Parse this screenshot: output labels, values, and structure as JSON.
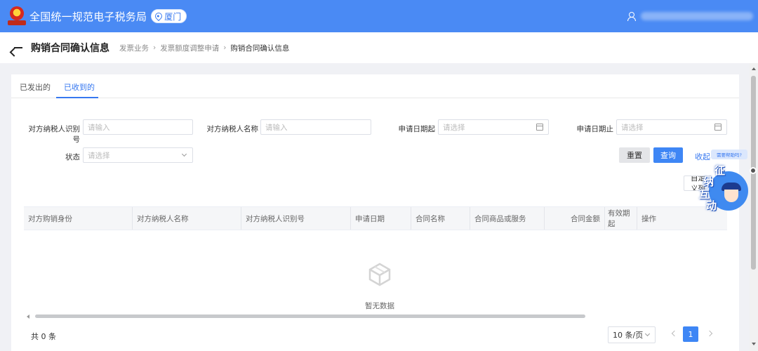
{
  "header": {
    "app_title": "全国统一规范电子税务局",
    "city": "厦门"
  },
  "page": {
    "title": "购销合同确认信息",
    "breadcrumbs": [
      "发票业务",
      "发票额度调整申请",
      "购销合同确认信息"
    ]
  },
  "tabs": [
    {
      "label": "已发出的",
      "active": false
    },
    {
      "label": "已收到的",
      "active": true
    }
  ],
  "filters": {
    "counterparty_id": {
      "label": "对方纳税人识别号",
      "placeholder": "请输入"
    },
    "counterparty_name": {
      "label": "对方纳税人名称",
      "placeholder": "请输入"
    },
    "date_start": {
      "label": "申请日期起",
      "placeholder": "请选择"
    },
    "date_end": {
      "label": "申请日期止",
      "placeholder": "请选择"
    },
    "status": {
      "label": "状态",
      "placeholder": "请选择"
    }
  },
  "actions": {
    "reset": "重置",
    "query": "查询",
    "collapse": "收起",
    "help": "需要帮助吗?",
    "custom_columns": "自定义列"
  },
  "table": {
    "columns": [
      "对方购销身份",
      "对方纳税人名称",
      "对方纳税人识别号",
      "申请日期",
      "合同名称",
      "合同商品或服务",
      "合同金额",
      "有效期起",
      "操作"
    ],
    "rows": [],
    "empty_text": "暂无数据"
  },
  "pagination": {
    "total_text": "共 0 条",
    "page_size": "10 条/页",
    "current_page": "1"
  },
  "assistant": {
    "chars": [
      "征",
      "纳",
      "互",
      "动"
    ]
  },
  "colors": {
    "brand": "#4a8af4",
    "primary": "#3e86f5"
  }
}
